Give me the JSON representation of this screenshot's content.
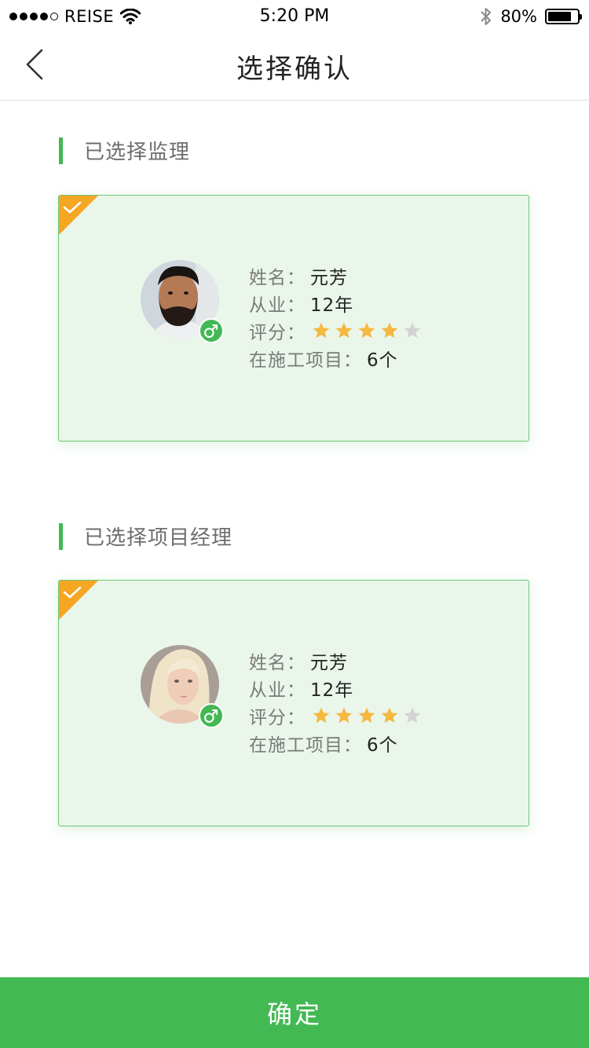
{
  "status_bar": {
    "carrier": "REISE",
    "time": "5:20 PM",
    "battery_percent": "80%",
    "battery_level": 0.8,
    "signal_bars_filled": 4,
    "signal_bars_total": 5
  },
  "nav": {
    "title": "选择确认",
    "back_icon": "chevron-left-icon"
  },
  "sections": [
    {
      "title": "已选择监理",
      "person": {
        "name_label": "姓名：",
        "name": "元芳",
        "experience_label": "从业：",
        "experience": "12年",
        "rating_label": "评分：",
        "rating": 4,
        "rating_max": 5,
        "projects_label": "在施工项目：",
        "projects": "6个",
        "gender_icon": "male-icon",
        "avatar": "avatar-man-beard",
        "selected": true
      }
    },
    {
      "title": "已选择项目经理",
      "person": {
        "name_label": "姓名：",
        "name": "元芳",
        "experience_label": "从业：",
        "experience": "12年",
        "rating_label": "评分：",
        "rating": 4,
        "rating_max": 5,
        "projects_label": "在施工项目：",
        "projects": "6个",
        "gender_icon": "male-icon",
        "avatar": "avatar-woman-blonde",
        "selected": true
      }
    }
  ],
  "confirm_button": {
    "label": "确定"
  },
  "colors": {
    "accent_green": "#43b954",
    "card_bg": "#eaf6ea",
    "badge_orange": "#f5a623",
    "star_active": "#f5b840",
    "star_inactive": "#d3d3d3"
  }
}
